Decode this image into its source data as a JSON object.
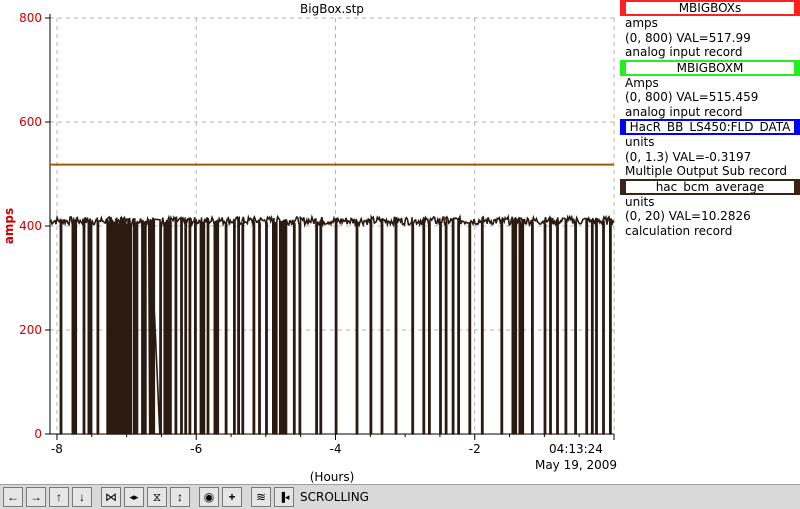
{
  "chart_data": {
    "type": "line",
    "title": "BigBox.stp",
    "ylabel": "amps",
    "xlabel": "(Hours)",
    "ylim": [
      0,
      800
    ],
    "xlim": [
      -8.1,
      0
    ],
    "yticks": [
      "0",
      "200",
      "400",
      "600",
      "800"
    ],
    "ytick_values": [
      0,
      200,
      400,
      600,
      800
    ],
    "xticks": [
      "-8",
      "-6",
      "-4",
      "-2"
    ],
    "xtick_values": [
      -8,
      -6,
      -4,
      -2
    ],
    "time_label": "04:13:24",
    "date_label": "May 19, 2009",
    "grid": true,
    "legend_position": "right",
    "y_axis_color": "#cc0000",
    "series": [
      {
        "name": "MBIGBOXs",
        "color": "#ff2020",
        "values": [
          518,
          518
        ]
      },
      {
        "name": "MBIGBOXM",
        "color": "#a05a00",
        "x": [
          -8.1,
          0
        ],
        "values": [
          517.99,
          517.99
        ]
      },
      {
        "name": "HacR_BB_LS450:FLD_DATA",
        "color": "#0000ff",
        "x": [
          -8.1,
          0
        ],
        "values": [
          -0.3197,
          -0.3197
        ]
      },
      {
        "name": "hac_bcm_average",
        "color": "#2b1a10",
        "baseline": 410,
        "dropout_x": [
          -7.95,
          -7.78,
          -7.74,
          -7.62,
          -7.55,
          -7.52,
          -7.42,
          -7.28,
          -7.24,
          -7.2,
          -7.17,
          -7.14,
          -7.1,
          -7.06,
          -7.02,
          -6.98,
          -6.95,
          -6.9,
          -6.86,
          -6.78,
          -6.74,
          -6.66,
          -6.62,
          -6.52,
          -6.46,
          -6.42,
          -6.38,
          -6.3,
          -6.22,
          -6.16,
          -6.1,
          -6.02,
          -5.94,
          -5.9,
          -5.84,
          -5.74,
          -5.7,
          -5.58,
          -5.46,
          -5.4,
          -5.34,
          -5.18,
          -5.1,
          -5.0,
          -4.9,
          -4.86,
          -4.8,
          -4.76,
          -4.72,
          -4.6,
          -4.52,
          -4.28,
          -4.22,
          -4.0,
          -3.7,
          -3.5,
          -3.34,
          -3.14,
          -2.9,
          -2.74,
          -2.66,
          -2.5,
          -2.42,
          -2.32,
          -2.24,
          -2.08,
          -1.9,
          -1.62,
          -1.46,
          -1.42,
          -1.36,
          -1.32,
          -1.18,
          -1.0,
          -0.92,
          -0.82,
          -0.7,
          -0.56,
          -0.4,
          -0.32,
          -0.26,
          -0.16,
          -0.06
        ],
        "flat_zero_range": [
          -6.68,
          -6.52
        ]
      }
    ]
  },
  "legend": [
    {
      "name": "MBIGBOXs",
      "border": "#ff2020",
      "units": "amps",
      "range_val": "(0, 800)  VAL=517.99",
      "record": "analog input record"
    },
    {
      "name": "MBIGBOXM",
      "border": "#22ee22",
      "units": "Amps",
      "range_val": "(0, 800) VAL=515.459",
      "record": "analog input record"
    },
    {
      "name": "HacR_BB_LS450:FLD_DATA",
      "border": "#0000ff",
      "units": "units",
      "range_val": "(0, 1.3) VAL=-0.3197",
      "record": "Multiple Output Sub record"
    },
    {
      "name": "hac_bcm_average",
      "border": "#3a2416",
      "units": "units",
      "range_val": "(0, 20) VAL=10.2826",
      "record": "calculation record"
    }
  ],
  "toolbar": {
    "buttons": [
      {
        "name": "scroll-left",
        "glyph": "←"
      },
      {
        "name": "scroll-right",
        "glyph": "→"
      },
      {
        "name": "scroll-up",
        "glyph": "↑"
      },
      {
        "name": "scroll-down",
        "glyph": "↓"
      },
      {
        "name": "compress-x",
        "glyph": "⋈"
      },
      {
        "name": "expand-x",
        "glyph": "◂▸"
      },
      {
        "name": "compress-y",
        "glyph": "⧖"
      },
      {
        "name": "expand-y",
        "glyph": "↕"
      },
      {
        "name": "zoom-auto",
        "glyph": "◉"
      },
      {
        "name": "add",
        "glyph": "+"
      },
      {
        "name": "scale",
        "glyph": "≋"
      },
      {
        "name": "back",
        "glyph": "▐◂"
      }
    ],
    "status": "SCROLLING"
  }
}
